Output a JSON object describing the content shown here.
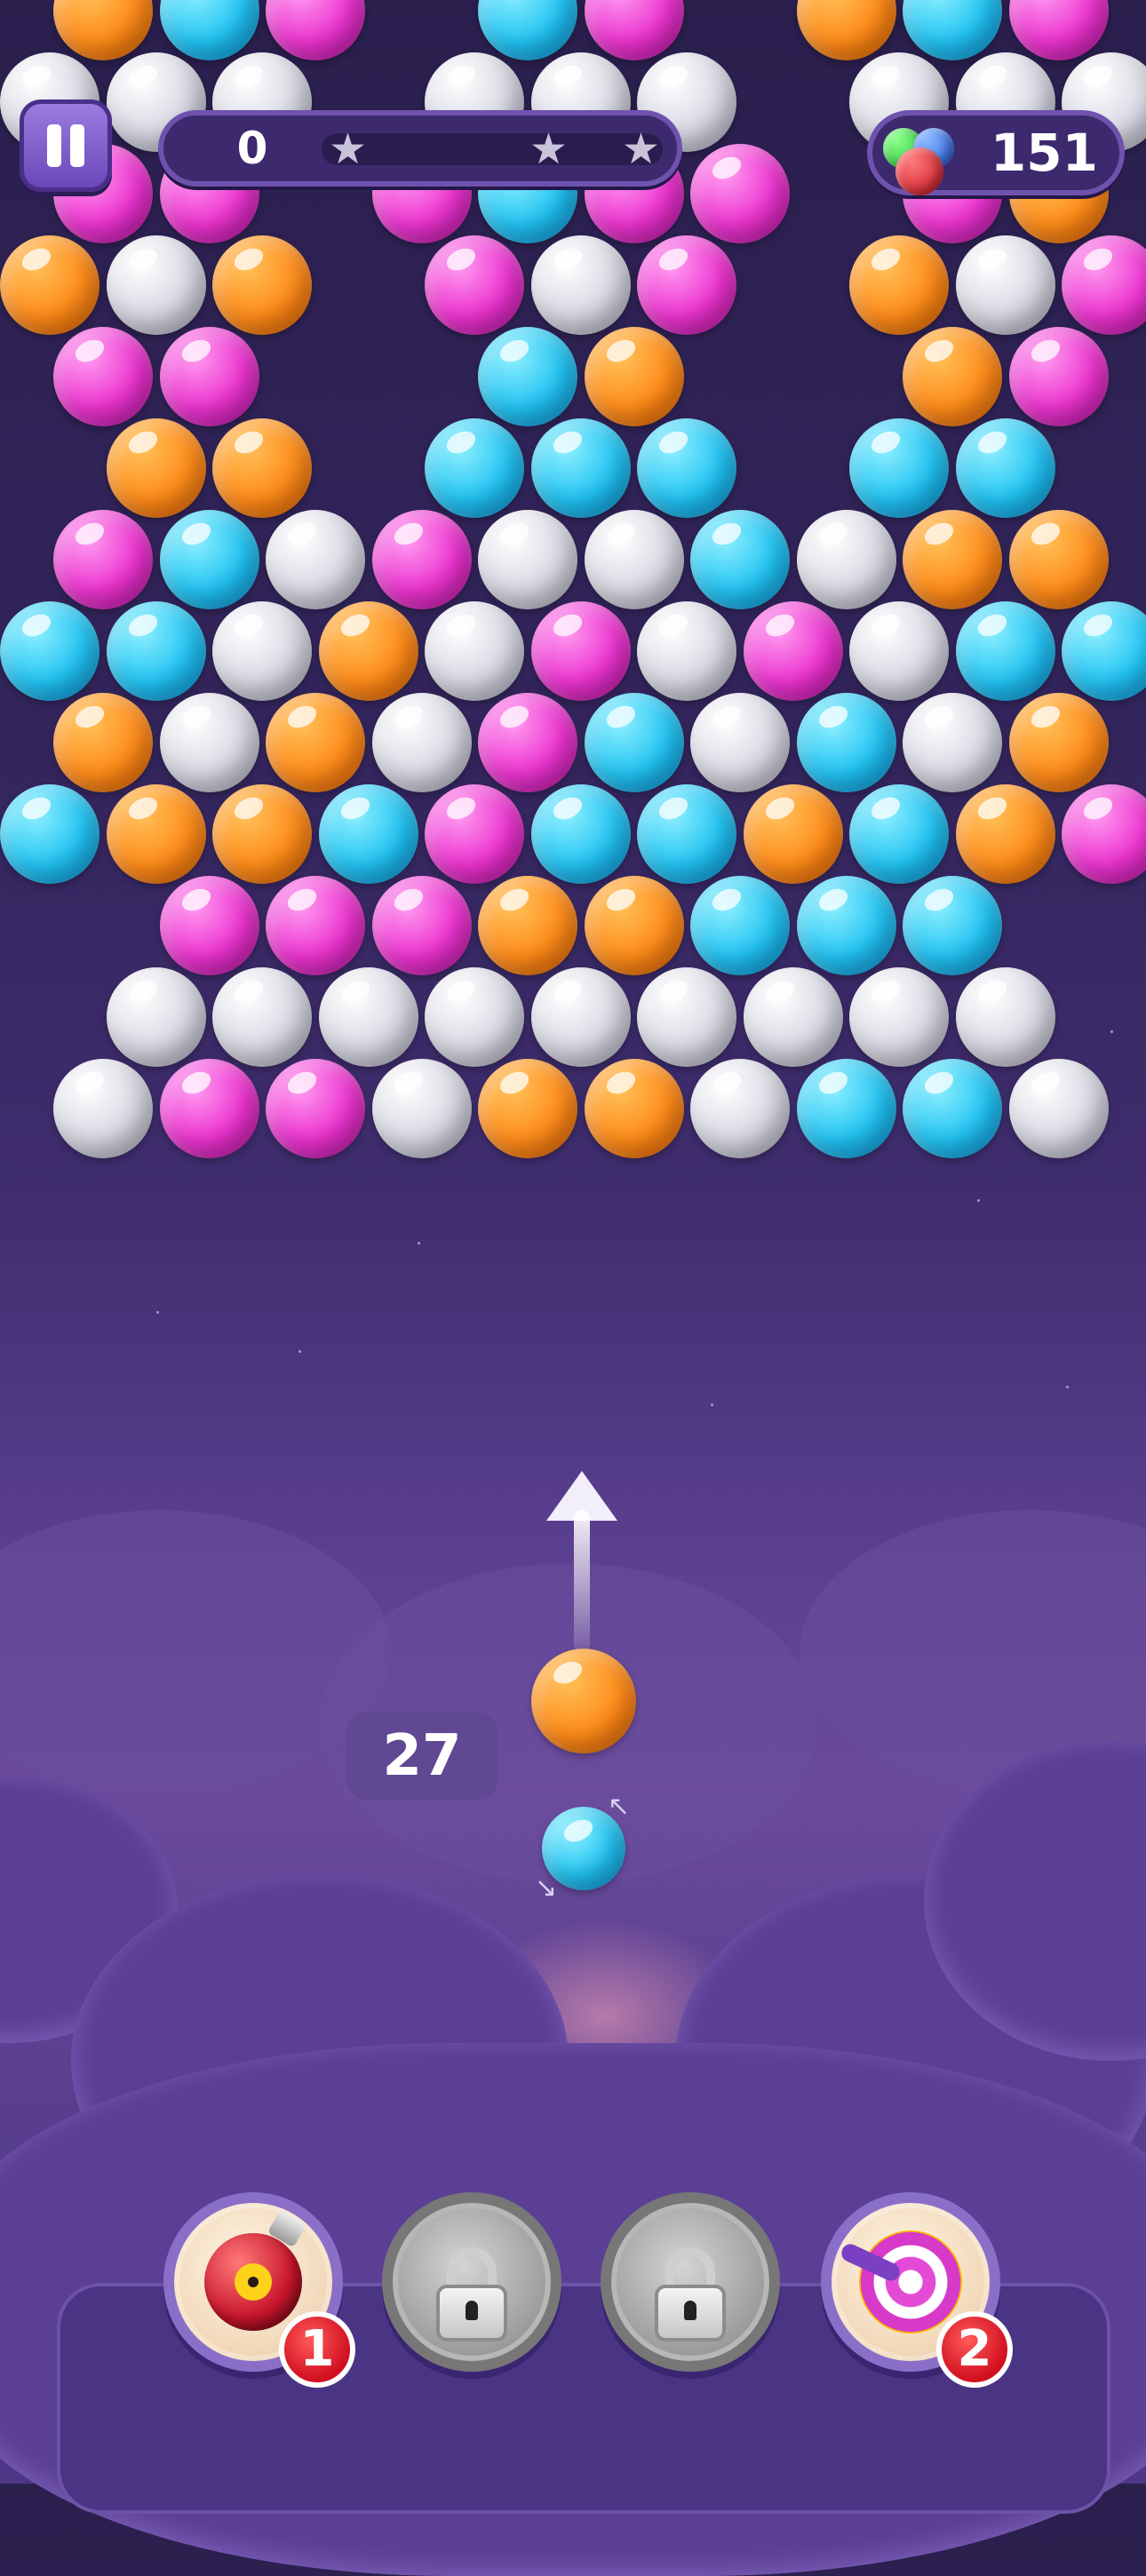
{
  "hud": {
    "score": "0",
    "coins": "151",
    "stars": [
      "star",
      "star",
      "star"
    ],
    "pause_icon": "pause-icon",
    "coin_icon": "color-balls-icon"
  },
  "shooter": {
    "moves_left": "27",
    "current_bubble": "orange",
    "next_bubble": "blue",
    "aim_icon": "aim-arrow-icon",
    "swap_icon": "swap-arrows-icon"
  },
  "boosters": [
    {
      "name": "bomb",
      "icon": "nuclear-bomb-icon",
      "count": "1",
      "locked": false
    },
    {
      "name": "slot-2",
      "icon": "lock-icon",
      "locked": true
    },
    {
      "name": "slot-3",
      "icon": "lock-icon",
      "locked": true
    },
    {
      "name": "target",
      "icon": "target-dart-icon",
      "count": "2",
      "locked": false
    }
  ],
  "colors": {
    "orange": "#ff8c1a",
    "blue": "#22c3f2",
    "pink": "#ec34cf",
    "silver": "#d6d7e2",
    "background": "#33255c",
    "badge": "#d10f1f"
  },
  "bubble_grid": [
    {
      "row": 0,
      "offset": true,
      "cells": [
        "orange",
        "blue",
        "pink",
        "",
        "blue",
        "pink",
        "",
        "orange",
        "blue",
        "pink"
      ]
    },
    {
      "row": 1,
      "offset": false,
      "cells": [
        "silver",
        "silver",
        "silver",
        "",
        "silver",
        "silver",
        "silver",
        "",
        "silver",
        "silver",
        "silver"
      ]
    },
    {
      "row": 2,
      "offset": true,
      "cells": [
        "pink",
        "pink",
        "",
        "pink",
        "blue",
        "pink",
        "pink",
        "",
        "pink",
        "orange"
      ]
    },
    {
      "row": 3,
      "offset": false,
      "cells": [
        "orange",
        "silver",
        "orange",
        "",
        "pink",
        "silver",
        "pink",
        "",
        "orange",
        "silver",
        "pink"
      ]
    },
    {
      "row": 4,
      "offset": true,
      "cells": [
        "pink",
        "pink",
        "",
        "",
        "blue",
        "orange",
        "",
        "",
        "orange",
        "pink"
      ]
    },
    {
      "row": 5,
      "offset": false,
      "cells": [
        "",
        "orange",
        "orange",
        "",
        "blue",
        "blue",
        "blue",
        "",
        "blue",
        "blue",
        ""
      ]
    },
    {
      "row": 6,
      "offset": true,
      "cells": [
        "pink",
        "blue",
        "silver",
        "pink",
        "silver",
        "silver",
        "blue",
        "silver",
        "orange",
        "orange"
      ]
    },
    {
      "row": 7,
      "offset": false,
      "cells": [
        "blue",
        "blue",
        "silver",
        "orange",
        "silver",
        "pink",
        "silver",
        "pink",
        "silver",
        "blue",
        "blue"
      ]
    },
    {
      "row": 8,
      "offset": true,
      "cells": [
        "orange",
        "silver",
        "orange",
        "silver",
        "pink",
        "blue",
        "silver",
        "blue",
        "silver",
        "orange"
      ]
    },
    {
      "row": 9,
      "offset": false,
      "cells": [
        "blue",
        "orange",
        "orange",
        "blue",
        "pink",
        "blue",
        "blue",
        "orange",
        "blue",
        "orange",
        "pink"
      ]
    },
    {
      "row": 10,
      "offset": true,
      "cells": [
        "",
        "pink",
        "pink",
        "pink",
        "orange",
        "orange",
        "blue",
        "blue",
        "blue",
        ""
      ]
    },
    {
      "row": 11,
      "offset": false,
      "cells": [
        "",
        "silver",
        "silver",
        "silver",
        "silver",
        "silver",
        "silver",
        "silver",
        "silver",
        "silver",
        ""
      ]
    },
    {
      "row": 12,
      "offset": true,
      "cells": [
        "silver",
        "pink",
        "pink",
        "silver",
        "orange",
        "orange",
        "silver",
        "blue",
        "blue",
        "silver"
      ]
    }
  ]
}
